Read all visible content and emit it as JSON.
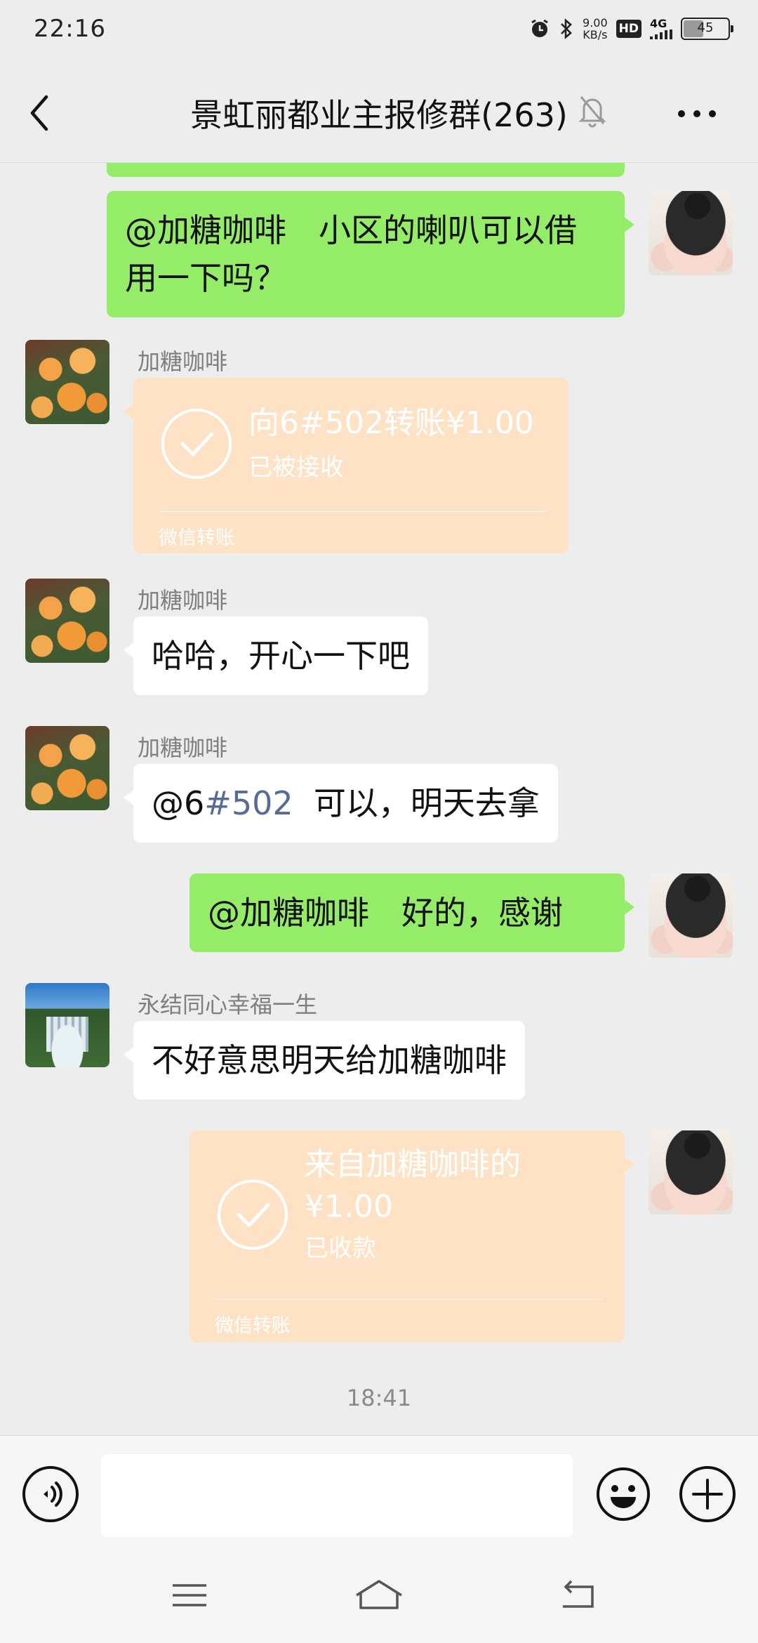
{
  "status_bar": {
    "time": "22:16",
    "net_speed_value": "9.00",
    "net_speed_unit": "KB/s",
    "hd_label": "HD",
    "network_label": "4G",
    "battery_level": "45"
  },
  "header": {
    "title": "景虹丽都业主报修群(263)"
  },
  "messages": [
    {
      "side": "right",
      "text": "@加糖咖啡　小区的喇叭可以借用一下吗？"
    },
    {
      "side": "left",
      "sender": "加糖咖啡",
      "type": "transfer",
      "title": "向6#502转账¥1.00",
      "status": "已被接收",
      "footer": "微信转账"
    },
    {
      "side": "left",
      "sender": "加糖咖啡",
      "text": "哈哈，开心一下吧"
    },
    {
      "side": "left",
      "sender": "加糖咖啡",
      "mention_prefix": "@6",
      "mention_link": "#502",
      "text_suffix": "  可以，明天去拿"
    },
    {
      "side": "right",
      "text": "@加糖咖啡　好的，感谢"
    },
    {
      "side": "left",
      "sender": "永结同心幸福一生",
      "text": "不好意思明天给加糖咖啡"
    },
    {
      "side": "right",
      "type": "transfer",
      "title_line1": "来自加糖咖啡的",
      "title_line2": "¥1.00",
      "status": "已收款",
      "footer": "微信转账"
    }
  ],
  "timestamp": "18:41",
  "input": {
    "value": ""
  },
  "colors": {
    "background": "#ededed",
    "my_bubble": "#95ec69",
    "other_bubble": "#ffffff",
    "transfer_card": "#fde2c6",
    "link": "#576b95"
  }
}
